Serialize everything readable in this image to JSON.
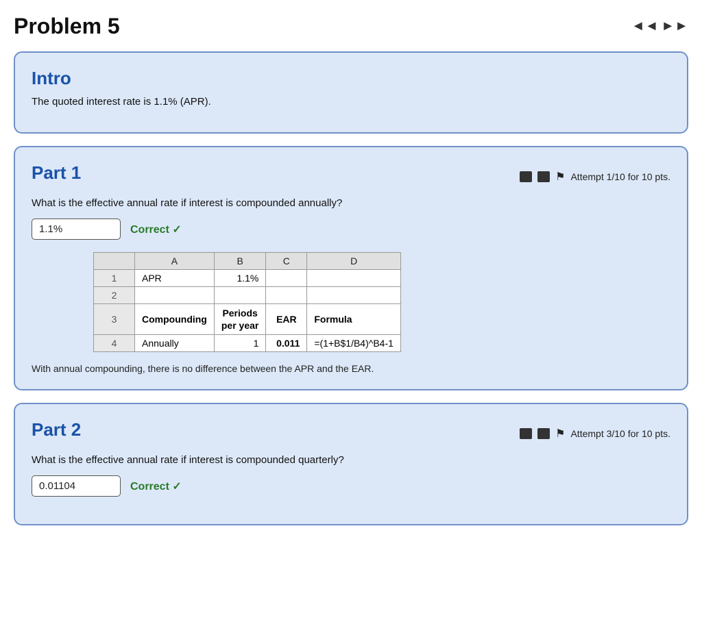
{
  "page": {
    "title": "Problem 5"
  },
  "nav": {
    "prev_label": "◄◄",
    "next_label": "►►"
  },
  "intro": {
    "section_title": "Intro",
    "text": "The quoted interest rate is 1.1% (APR)."
  },
  "part1": {
    "section_title": "Part 1",
    "attempt_text": "Attempt 1/10 for 10 pts.",
    "question": "What is the effective annual rate if interest is compounded annually?",
    "answer_value": "1.1%",
    "correct_text": "Correct ✓",
    "explanation": "With annual compounding, there is no difference between the APR and the EAR.",
    "spreadsheet": {
      "col_headers": [
        "",
        "A",
        "B",
        "C",
        "D"
      ],
      "rows": [
        {
          "row_num": "1",
          "cells": [
            "APR",
            "1.1%",
            "",
            ""
          ]
        },
        {
          "row_num": "2",
          "cells": [
            "",
            "",
            "",
            ""
          ]
        },
        {
          "row_num": "3",
          "cells": [
            "Compounding",
            "Periods\nper year",
            "EAR",
            "Formula"
          ],
          "bold_cols": [
            0,
            2,
            3
          ]
        },
        {
          "row_num": "4",
          "cells": [
            "Annually",
            "1",
            "0.011",
            "=(1+B$1/B4)^B4-1"
          ],
          "bold_cols": [
            2
          ]
        }
      ]
    }
  },
  "part2": {
    "section_title": "Part 2",
    "attempt_text": "Attempt 3/10 for 10 pts.",
    "question": "What is the effective annual rate if interest is compounded quarterly?",
    "answer_value": "0.01104",
    "correct_text": "Correct ✓"
  },
  "icons": {
    "prev": "◄◄",
    "next": "►►",
    "flag": "⚑"
  }
}
